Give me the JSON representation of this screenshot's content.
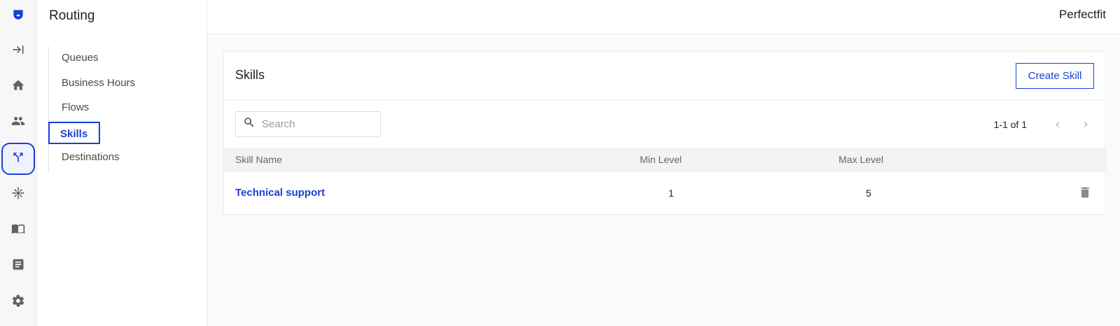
{
  "rail": {
    "items": [
      {
        "icon": "logo-icon"
      },
      {
        "icon": "expand-collapse-icon"
      },
      {
        "icon": "home-icon"
      },
      {
        "icon": "users-icon"
      },
      {
        "icon": "routing-icon",
        "active": true
      },
      {
        "icon": "integrations-icon"
      },
      {
        "icon": "knowledge-book-icon"
      },
      {
        "icon": "reports-icon"
      },
      {
        "icon": "settings-icon"
      }
    ],
    "accent": "#1a3fd8"
  },
  "subnav": {
    "title": "Routing",
    "items": [
      {
        "label": "Queues"
      },
      {
        "label": "Business Hours"
      },
      {
        "label": "Flows"
      },
      {
        "label": "Skills",
        "active": true
      },
      {
        "label": "Destinations"
      }
    ]
  },
  "topbar": {
    "org_name": "Perfectfit"
  },
  "skills": {
    "title": "Skills",
    "create_label": "Create Skill",
    "search_placeholder": "Search",
    "search_value": "",
    "pager_text": "1-1 of 1",
    "columns": {
      "name": "Skill Name",
      "min": "Min Level",
      "max": "Max Level"
    },
    "rows": [
      {
        "name": "Technical support",
        "min": "1",
        "max": "5"
      }
    ]
  }
}
